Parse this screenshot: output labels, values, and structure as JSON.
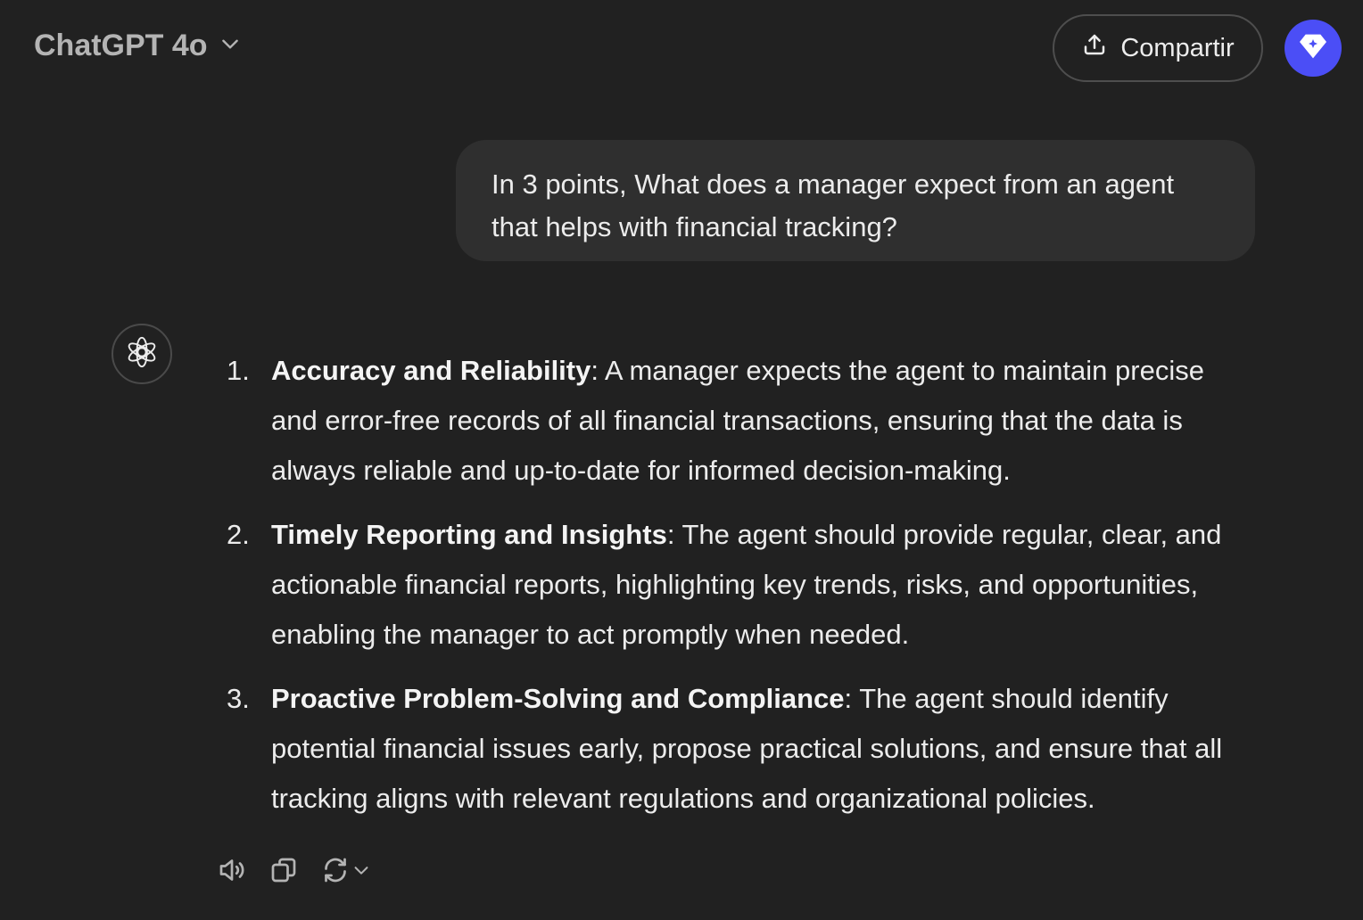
{
  "header": {
    "model_name": "ChatGPT 4o",
    "share_label": "Compartir"
  },
  "conversation": {
    "user_message": "In 3 points, What does a manager expect from an agent that helps with financial tracking?",
    "assistant_items": [
      {
        "number": "1.",
        "title": "Accuracy and Reliability",
        "text": ": A manager expects the agent to maintain precise and error-free records of all financial transactions, ensuring that the data is always reliable and up-to-date for informed decision-making."
      },
      {
        "number": "2.",
        "title": "Timely Reporting and Insights",
        "text": ": The agent should provide regular, clear, and actionable financial reports, highlighting key trends, risks, and opportunities, enabling the manager to act promptly when needed."
      },
      {
        "number": "3.",
        "title": "Proactive Problem-Solving and Compliance",
        "text": ": The agent should identify potential financial issues early, propose practical solutions, and ensure that all tracking aligns with relevant regulations and organizational policies."
      }
    ]
  },
  "icons": {
    "model_switcher": "chevron-down-icon",
    "share": "upload-icon",
    "avatar": "diamond-icon",
    "assistant": "openai-logo-icon",
    "actions": [
      "speaker-icon",
      "copy-icon",
      "regenerate-icon",
      "chevron-down-icon"
    ]
  },
  "colors": {
    "background": "#212121",
    "bubble": "#2f2f2f",
    "avatar": "#4b4ef6",
    "text": "#ececec"
  }
}
